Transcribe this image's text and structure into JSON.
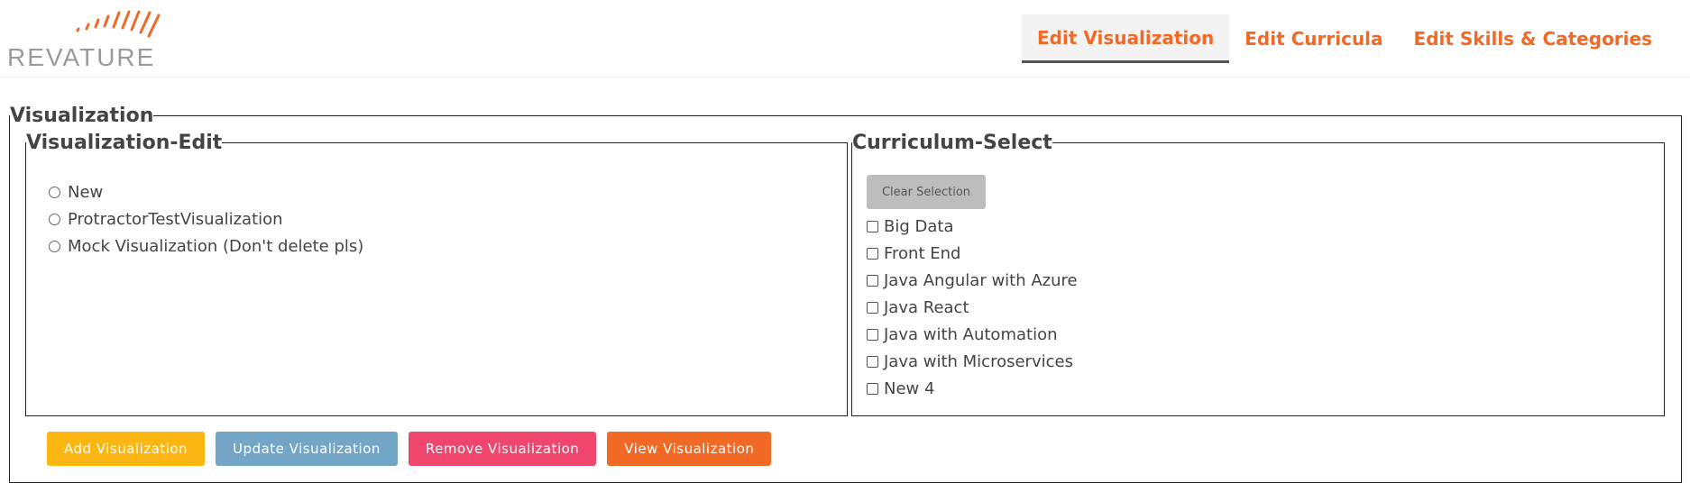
{
  "brand": {
    "logo_text": "REVATURE",
    "accent_color": "#f26925"
  },
  "nav": {
    "items": [
      {
        "label": "Edit Visualization",
        "active": true
      },
      {
        "label": "Edit Curricula",
        "active": false
      },
      {
        "label": "Edit Skills & Categories",
        "active": false
      }
    ]
  },
  "visualization": {
    "legend": "Visualization",
    "edit": {
      "legend": "Visualization-Edit",
      "options": [
        {
          "label": "New",
          "selected": false
        },
        {
          "label": "ProtractorTestVisualization",
          "selected": false
        },
        {
          "label": "Mock Visualization (Don't delete pls)",
          "selected": false
        }
      ]
    },
    "curriculum": {
      "legend": "Curriculum-Select",
      "clear_label": "Clear Selection",
      "items": [
        {
          "label": "Big Data",
          "checked": false
        },
        {
          "label": "Front End",
          "checked": false
        },
        {
          "label": "Java Angular with Azure",
          "checked": false
        },
        {
          "label": "Java React",
          "checked": false
        },
        {
          "label": "Java with Automation",
          "checked": false
        },
        {
          "label": "Java with Microservices",
          "checked": false
        },
        {
          "label": "New 4",
          "checked": false
        }
      ]
    },
    "actions": [
      {
        "label": "Add Visualization",
        "color": "#fbb612"
      },
      {
        "label": "Update Visualization",
        "color": "#73a5c6"
      },
      {
        "label": "Remove Visualization",
        "color": "#f0466e"
      },
      {
        "label": "View Visualization",
        "color": "#f26925"
      }
    ]
  }
}
